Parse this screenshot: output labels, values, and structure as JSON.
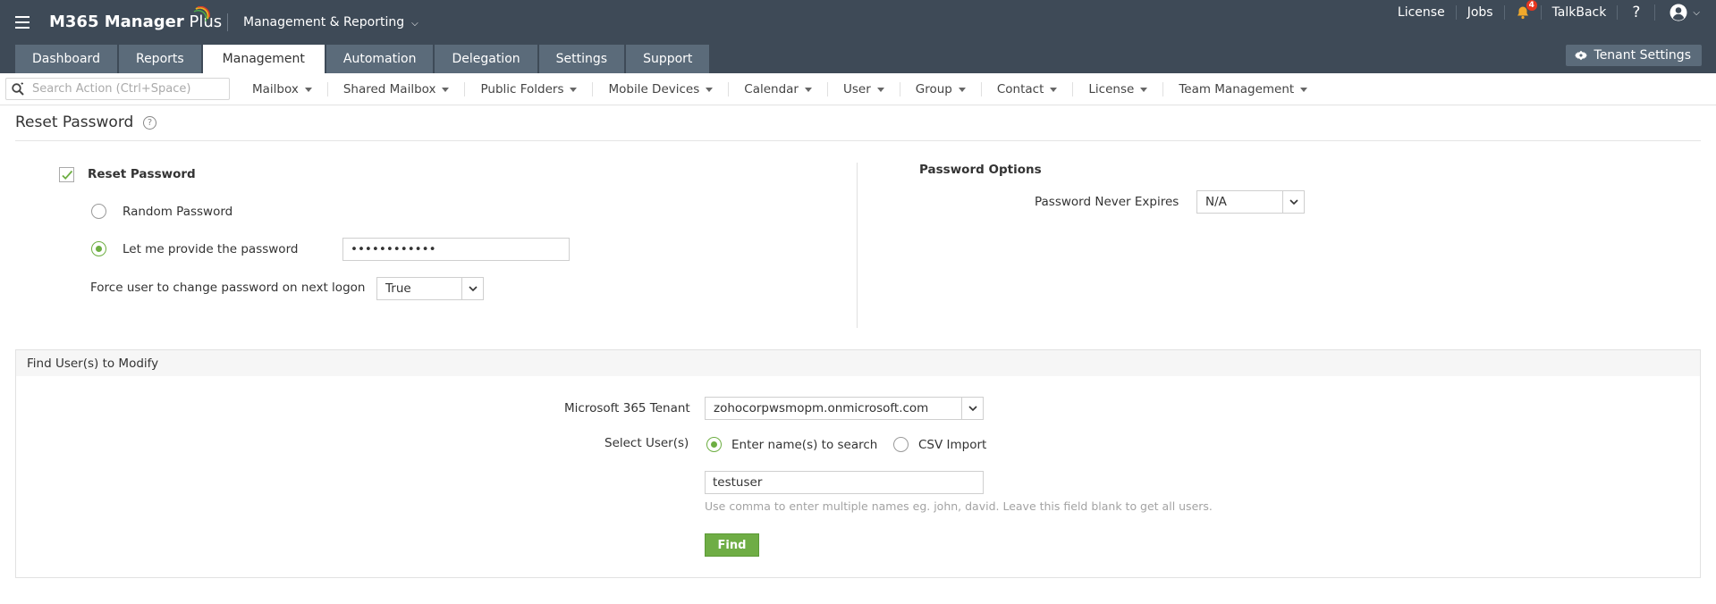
{
  "header": {
    "logo_main": "M365 Manager",
    "logo_plus": " Plus",
    "product_menu": "Management & Reporting",
    "top_links": {
      "license": "License",
      "jobs": "Jobs",
      "talkback": "TalkBack",
      "help": "?"
    },
    "notification_count": "4",
    "tenant_settings": "Tenant Settings",
    "tabs": [
      {
        "label": "Dashboard"
      },
      {
        "label": "Reports"
      },
      {
        "label": "Management",
        "active": true
      },
      {
        "label": "Automation"
      },
      {
        "label": "Delegation"
      },
      {
        "label": "Settings"
      },
      {
        "label": "Support"
      }
    ]
  },
  "actionbar": {
    "search_placeholder": "Search Action (Ctrl+Space)",
    "menus": [
      {
        "label": "Mailbox"
      },
      {
        "label": "Shared Mailbox"
      },
      {
        "label": "Public Folders"
      },
      {
        "label": "Mobile Devices"
      },
      {
        "label": "Calendar"
      },
      {
        "label": "User"
      },
      {
        "label": "Group"
      },
      {
        "label": "Contact"
      },
      {
        "label": "License"
      },
      {
        "label": "Team Management"
      }
    ]
  },
  "page": {
    "title": "Reset Password",
    "help": "?"
  },
  "reset": {
    "checkbox_label": "Reset Password",
    "checked": true,
    "random_password_label": "Random Password",
    "provide_password_label": "Let me provide the password",
    "password_value": "••••••••••••",
    "force_change_label": "Force user to change password on next logon",
    "force_change_value": "True"
  },
  "options": {
    "title": "Password Options",
    "never_expires_label": "Password Never Expires",
    "never_expires_value": "N/A"
  },
  "find": {
    "panel_title": "Find User(s) to Modify",
    "tenant_label": "Microsoft 365 Tenant",
    "tenant_value": "zohocorpwsmopm.onmicrosoft.com",
    "select_users_label": "Select User(s)",
    "enter_names_label": "Enter name(s) to search",
    "csv_import_label": "CSV Import",
    "names_value": "testuser",
    "hint": "Use comma to enter multiple names eg. john, david. Leave this field blank to get all users.",
    "find_button": "Find"
  },
  "colors": {
    "header_bg": "#3e4a57",
    "tab_bg": "#5b6b7a",
    "accent_green": "#6fad45",
    "badge_red": "#e8361f"
  }
}
